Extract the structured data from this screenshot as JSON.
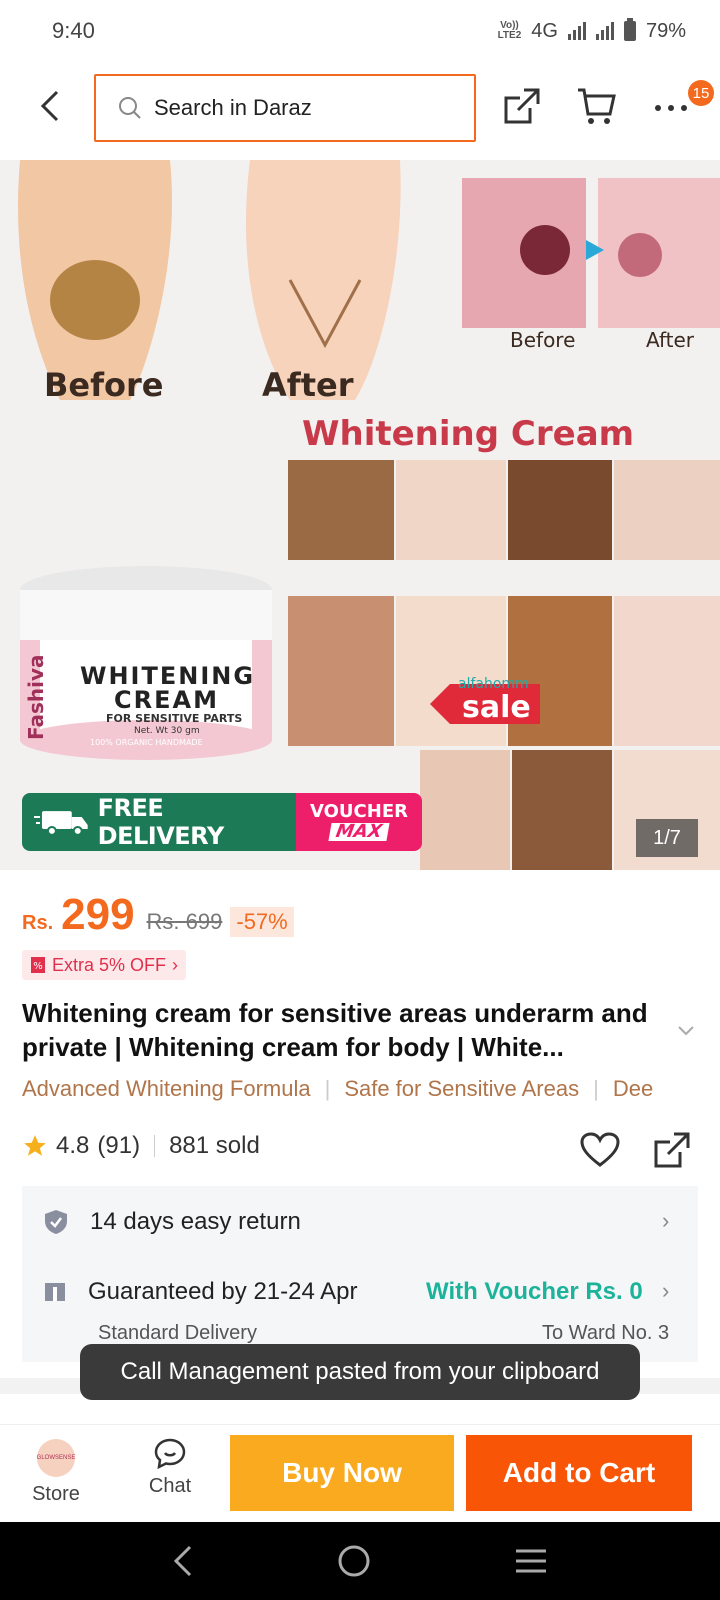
{
  "status_bar": {
    "time": "9:40",
    "volte": "Vo)) LTE2",
    "network": "4G",
    "battery": "79%"
  },
  "header": {
    "search_placeholder": "Search in Daraz",
    "cart_badge": "15"
  },
  "product_image": {
    "before_label": "Before",
    "after_label": "After",
    "small_before": "Before",
    "small_after": "After",
    "title": "Whitening Cream",
    "jar_brand": "Fashiva",
    "jar_line1": "WHITENING",
    "jar_line2": "CREAM",
    "jar_line3": "FOR SENSITIVE PARTS",
    "jar_line4": "Net. Wt 30 gm",
    "jar_line5": "100% ORGANIC  HANDMADE",
    "sale_watermark": "alfahomm",
    "sale_tag": "sale",
    "free_tag": "FREE",
    "free_delivery": "FREE DELIVERY",
    "voucher": "VOUCHER",
    "voucher_max": "MAX",
    "counter": "1/7"
  },
  "price": {
    "currency": "Rs.",
    "value": "299",
    "old_price": "Rs. 699",
    "discount": "-57%",
    "extra_off": "Extra 5% OFF"
  },
  "product": {
    "title": "Whitening cream for sensitive areas underarm and private | Whitening cream for body | White...",
    "features": [
      "Advanced Whitening Formula",
      "Safe for Sensitive Areas",
      "Dee"
    ],
    "rating": "4.8",
    "reviews": "(91)",
    "sold": "881 sold"
  },
  "service": {
    "return_text": "14 days easy return",
    "guarantee_text": "Guaranteed by 21-24 Apr",
    "voucher_text": "With Voucher Rs. 0",
    "delivery_type": "Standard Delivery",
    "delivery_to": "To Ward No. 3"
  },
  "toast": {
    "text": "Call Management pasted from your clipboard"
  },
  "action_bar": {
    "store_label": "Store",
    "store_avatar_text": "GLOWSENSE",
    "chat_label": "Chat",
    "buy_now": "Buy Now",
    "add_to_cart": "Add to Cart"
  },
  "colors": {
    "accent": "#f85606",
    "buy_now": "#faaa1e",
    "voucher_green": "#1bb39a",
    "free_delivery_green": "#1c7a57",
    "voucher_pink": "#ee1f6a"
  }
}
